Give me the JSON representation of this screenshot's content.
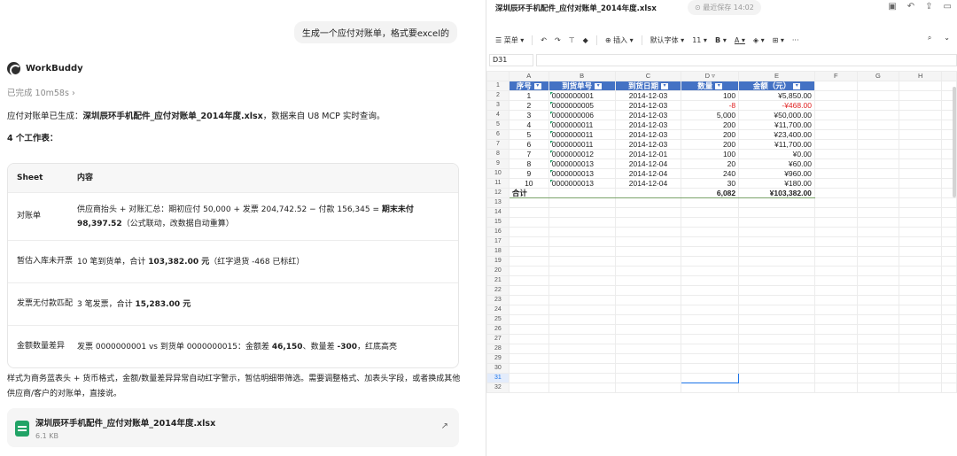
{
  "chat": {
    "user_message": "生成一个应付对账单，格式要excel的",
    "brand": "WorkBuddy",
    "status": "已完成 10m58s",
    "intro_prefix": "应付对账单已生成：",
    "intro_file": "深圳辰环手机配件_应付对账单_2014年度.xlsx",
    "intro_suffix": "，数据来自 U8 MCP 实时查询。",
    "sheets_title": "4 个工作表：",
    "table_headers": [
      "Sheet",
      "内容"
    ],
    "rows": [
      {
        "sheet": "对账单",
        "pre": "供应商抬头 + 对账汇总：期初应付 50,000 + 发票 204,742.52 − 付款 156,345 = ",
        "bold": "期末未付 98,397.52",
        "post": "（公式联动，改数据自动重算）"
      },
      {
        "sheet": "暂估入库未开票",
        "pre": "10 笔到货单，合计 ",
        "bold": "103,382.00 元",
        "post": "（红字退货 -468 已标红）"
      },
      {
        "sheet": "发票无付款匹配",
        "pre": "3 笔发票，合计 ",
        "bold": "15,283.00 元",
        "post": ""
      },
      {
        "sheet": "金额数量差异",
        "pre": "发票 0000000001 vs 到货单 0000000015：金额差 ",
        "bold": "46,150",
        "mid": "、数量差 ",
        "bold2": "-300",
        "post": "，红底高亮"
      }
    ],
    "footer": "样式为商务蓝表头 + 货币格式，金额/数量差异异常自动红字警示，暂估明细带筛选。需要调整格式、加表头字段，或者换成其他供应商/客户的对账单，直接说。",
    "file_name": "深圳辰环手机配件_应付对账单_2014年度.xlsx",
    "file_size": "6.1 KB"
  },
  "sheet": {
    "doc_title": "深圳辰环手机配件_应付对账单_2014年度.xlsx",
    "save_status": "最近保存 14:02",
    "toolbar": {
      "menu": "菜单",
      "insert": "插入",
      "font": "默认字体",
      "font_size": "11",
      "bold": "B",
      "underline_a": "A",
      "more": "···"
    },
    "name_box": "D31",
    "columns": [
      "A",
      "B",
      "C",
      "D",
      "E",
      "F",
      "G",
      "H"
    ],
    "headers": [
      "序号",
      "到货单号",
      "到货日期",
      "数量",
      "金额（元）"
    ],
    "rows": [
      [
        "1",
        "0000000001",
        "2014-12-03",
        "100",
        "¥5,850.00"
      ],
      [
        "2",
        "0000000005",
        "2014-12-03",
        "-8",
        "-¥468.00"
      ],
      [
        "3",
        "0000000006",
        "2014-12-03",
        "5,000",
        "¥50,000.00"
      ],
      [
        "4",
        "0000000011",
        "2014-12-03",
        "200",
        "¥11,700.00"
      ],
      [
        "5",
        "0000000011",
        "2014-12-03",
        "200",
        "¥23,400.00"
      ],
      [
        "6",
        "0000000011",
        "2014-12-03",
        "200",
        "¥11,700.00"
      ],
      [
        "7",
        "0000000012",
        "2014-12-01",
        "100",
        "¥0.00"
      ],
      [
        "8",
        "0000000013",
        "2014-12-04",
        "20",
        "¥60.00"
      ],
      [
        "9",
        "0000000013",
        "2014-12-04",
        "240",
        "¥960.00"
      ],
      [
        "10",
        "0000000013",
        "2014-12-04",
        "30",
        "¥180.00"
      ]
    ],
    "total": [
      "合计",
      "6,082",
      "¥103,382.00"
    ],
    "row_numbers": [
      "1",
      "2",
      "3",
      "4",
      "5",
      "6",
      "7",
      "8",
      "9",
      "10",
      "11",
      "12",
      "13",
      "14",
      "15",
      "16",
      "17",
      "18",
      "19",
      "20",
      "21",
      "22",
      "23",
      "24",
      "25",
      "26",
      "27",
      "28",
      "29",
      "30",
      "31",
      "32"
    ],
    "colors": {
      "header_blue": "#4472c4",
      "negative_red": "#e02020",
      "selection": "#1a73e8"
    }
  }
}
